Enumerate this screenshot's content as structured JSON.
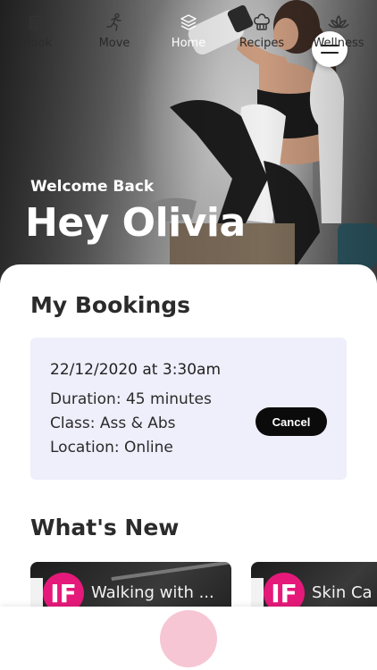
{
  "hero": {
    "welcome": "Welcome Back",
    "greeting": "Hey Olivia"
  },
  "bookings": {
    "title": "My Bookings",
    "items": [
      {
        "datetime": "22/12/2020 at 3:30am",
        "duration": "Duration: 45 minutes",
        "class": "Class: Ass & Abs",
        "location": "Location: Online",
        "cancel_label": "Cancel"
      }
    ]
  },
  "whats_new": {
    "title": "What's New",
    "cards": [
      {
        "title": "Walking with ...",
        "logo": "IF"
      },
      {
        "title": "Skin Ca",
        "logo": "IF"
      }
    ]
  },
  "tabbar": {
    "items": [
      {
        "label": "Book",
        "icon": "calendar-icon"
      },
      {
        "label": "Move",
        "icon": "running-icon"
      },
      {
        "label": "Home",
        "icon": "layers-icon",
        "active": true
      },
      {
        "label": "Recipes",
        "icon": "chef-hat-icon"
      },
      {
        "label": "Wellness",
        "icon": "lotus-icon"
      }
    ]
  },
  "colors": {
    "accent_pink": "#e5197a",
    "home_bubble": "#f6c6d4",
    "card_bg": "#efeefb",
    "cancel_bg": "#0b0b0b"
  }
}
